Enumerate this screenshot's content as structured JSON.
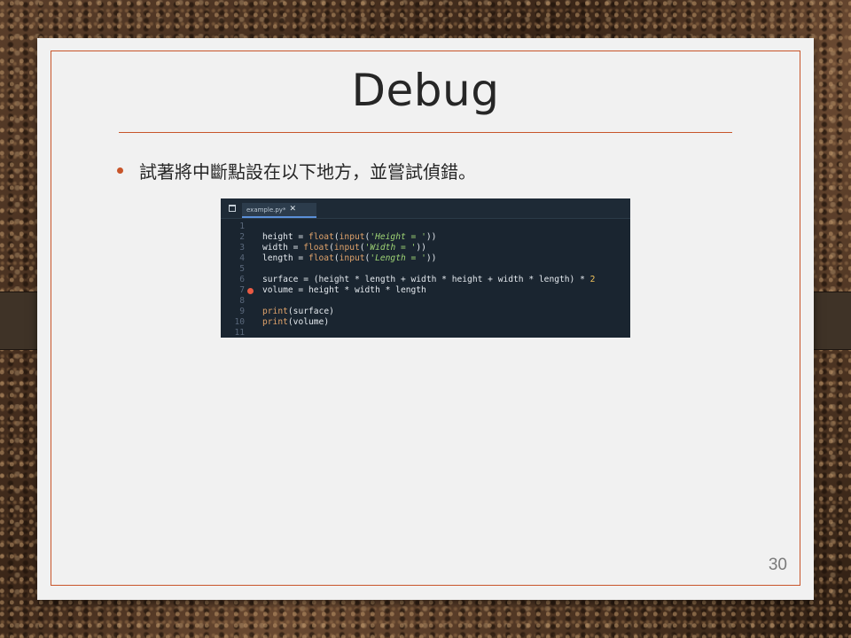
{
  "slide": {
    "title": "Debug",
    "bullet": "試著將中斷點設在以下地方，並嘗試偵錯。",
    "page_number": "30"
  },
  "editor": {
    "tab_label": "example.py*",
    "tab_close": "✕",
    "breakpoint_line": 7,
    "lines": [
      {
        "n": "1",
        "code": ""
      },
      {
        "n": "2",
        "code": "height = float(input('Height = '))"
      },
      {
        "n": "3",
        "code": "width = float(input('Width = '))"
      },
      {
        "n": "4",
        "code": "length = float(input('Length = '))"
      },
      {
        "n": "5",
        "code": ""
      },
      {
        "n": "6",
        "code": "surface = (height * length + width * height + width * length) * 2"
      },
      {
        "n": "7",
        "code": "volume = height * width * length"
      },
      {
        "n": "8",
        "code": ""
      },
      {
        "n": "9",
        "code": "print(surface)"
      },
      {
        "n": "10",
        "code": "print(volume)"
      },
      {
        "n": "11",
        "code": ""
      }
    ]
  },
  "colors": {
    "accent": "#c8552a",
    "editor_bg": "#1a2530",
    "breakpoint": "#ea5a43"
  }
}
